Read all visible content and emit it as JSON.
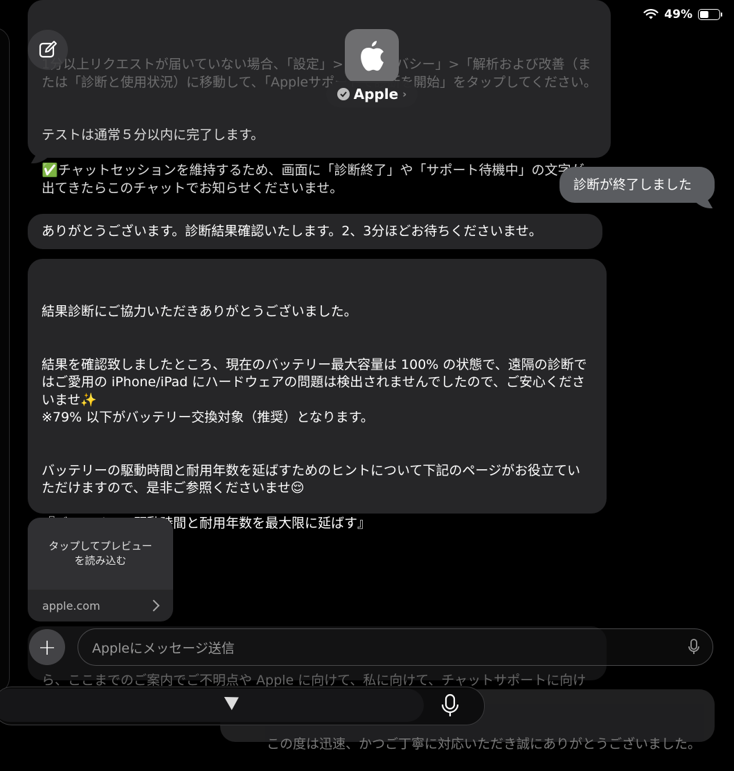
{
  "status_bar": {
    "battery_percent": "49%",
    "battery_level": 0.49
  },
  "header": {
    "contact_name": "Apple",
    "avatar_icon": "apple-logo-icon",
    "compose_icon": "compose-icon",
    "verified_icon": "verified-badge-icon"
  },
  "messages": [
    {
      "id": "m1",
      "direction": "received",
      "faded_text": "1分以上リクエストが届いていない場合、「設定」>「プライバシー」>「解析および改善（または「診断と使用状況）に移動して、「Appleサポートで診断を開始」をタップしてください。",
      "text": "テストは通常５分以内に完了します。\n\n✅チャットセッションを維持するため、画面に「診断終了」や「サポート待機中」の文字が出てきたらこのチャットでお知らせくださいませ。"
    },
    {
      "id": "m2",
      "direction": "sent",
      "text": "診断が終了しました"
    },
    {
      "id": "m3",
      "direction": "received",
      "text": "ありがとうございます。診断結果確認いたします。2、3分ほどお待ちくださいませ。"
    },
    {
      "id": "m4",
      "direction": "received",
      "text": "結果診断にご協力いただきありがとうございました。\n\n\n結果を確認致しましたところ、現在のバッテリー最大容量は 100% の状態で、遠隔の診断ではご愛用の iPhone/iPad にハードウェアの問題は検出されませんでしたので、ご安心くださいませ✨\n※79% 以下がバッテリー交換対象（推奨）となります。\n\n\nバッテリーの駆動時間と耐用年数を延ばすためのヒントについて下記のページがお役立ていただけますので、是非ご参照くださいませ😌\n\n『バッテリーの駆動時間と耐用年数を最大限に延ばす』"
    },
    {
      "id": "m5",
      "direction": "received",
      "type": "link_preview",
      "preview_text": "タップしてプレビュー\nを読み込む",
      "domain": "apple.com"
    },
    {
      "id": "m6",
      "direction": "received",
      "faded": true,
      "text": "ら、ここまでのご案内でご不明点や Apple に向けて、私に向けて、チャットサポートに向けてのメッセージなどあれば教えてくださいませ。"
    },
    {
      "id": "m7",
      "direction": "sent",
      "faded": true,
      "text": "この度は迅速、かつご丁寧に対応いただき誠にありがとうございました。"
    }
  ],
  "composer": {
    "placeholder": "Appleにメッセージ送信",
    "plus_label": "+",
    "mic_icon": "microphone-icon"
  }
}
